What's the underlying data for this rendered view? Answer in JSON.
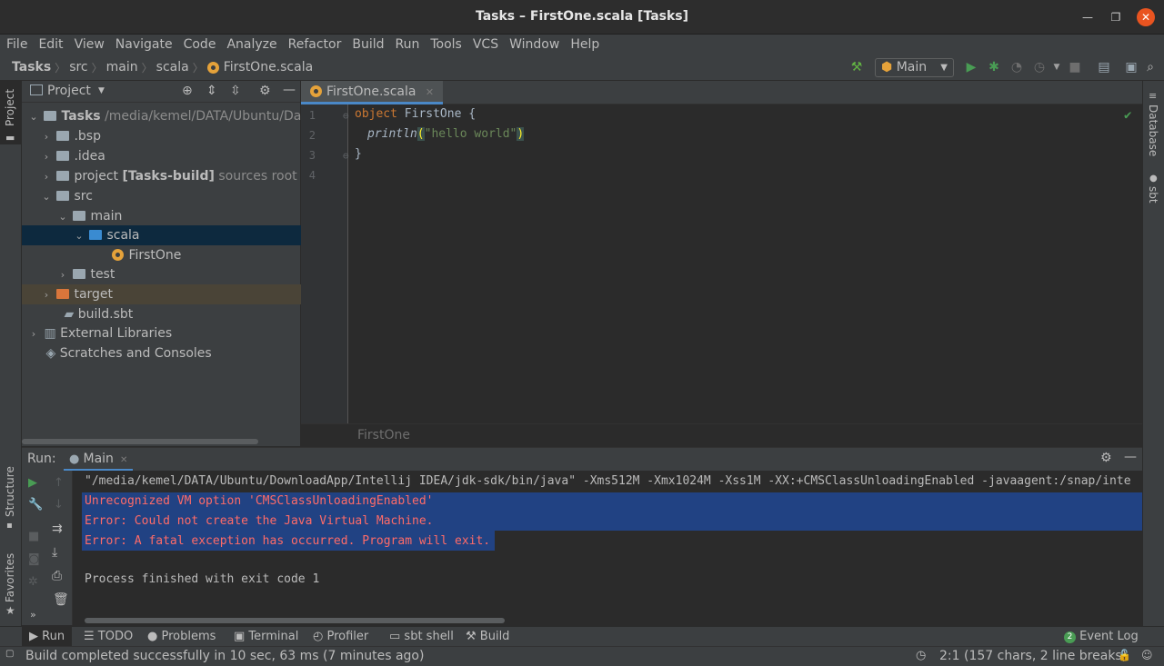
{
  "window": {
    "title": "Tasks – FirstOne.scala [Tasks]"
  },
  "menu": [
    "File",
    "Edit",
    "View",
    "Navigate",
    "Code",
    "Analyze",
    "Refactor",
    "Build",
    "Run",
    "Tools",
    "VCS",
    "Window",
    "Help"
  ],
  "nav": {
    "crumbs": [
      "Tasks",
      "src",
      "main",
      "scala",
      "FirstOne.scala"
    ],
    "run_config": "Main"
  },
  "left_strip": {
    "project_label": "Project",
    "structure_label": "Structure",
    "favorites_label": "Favorites"
  },
  "right_strip": {
    "database_label": "Database",
    "sbt_label": "sbt"
  },
  "project_panel": {
    "title": "Project",
    "tree": [
      {
        "label": "Tasks",
        "suffix": "/media/kemel/DATA/Ubuntu/Da",
        "bold": true
      },
      {
        "label": ".bsp"
      },
      {
        "label": ".idea"
      },
      {
        "label": "project",
        "bold_suffix": "[Tasks-build]",
        "suffix": "sources root"
      },
      {
        "label": "src"
      },
      {
        "label": "main"
      },
      {
        "label": "scala"
      },
      {
        "label": "FirstOne"
      },
      {
        "label": "test"
      },
      {
        "label": "target"
      },
      {
        "label": "build.sbt"
      },
      {
        "label": "External Libraries"
      },
      {
        "label": "Scratches and Consoles"
      }
    ]
  },
  "editor": {
    "tab": "FirstOne.scala",
    "line_numbers": [
      "1",
      "2",
      "3",
      "4"
    ],
    "code": {
      "l1_kw": "object",
      "l1_rest": " FirstOne {",
      "l2_fn": "println",
      "l2_open": "(",
      "l2_str": "\"hello world\"",
      "l2_close": ")",
      "l3": "}"
    },
    "breadcrumb": "FirstOne"
  },
  "run": {
    "label": "Run:",
    "tab": "Main",
    "console": [
      "\"/media/kemel/DATA/Ubuntu/DownloadApp/Intellij IDEA/jdk-sdk/bin/java\" -Xms512M -Xmx1024M -Xss1M -XX:+CMSClassUnloadingEnabled -javaagent:/snap/inte",
      "Unrecognized VM option 'CMSClassUnloadingEnabled'",
      "Error: Could not create the Java Virtual Machine.",
      "Error: A fatal exception has occurred. Program will exit.",
      "",
      "Process finished with exit code 1"
    ]
  },
  "bottom_tools": [
    "Run",
    "TODO",
    "Problems",
    "Terminal",
    "Profiler",
    "sbt shell",
    "Build"
  ],
  "event_log": {
    "count": "2",
    "label": "Event Log"
  },
  "status": {
    "message": "Build completed successfully in 10 sec, 63 ms (7 minutes ago)",
    "position": "2:1 (157 chars, 2 line breaks)"
  },
  "colors": {
    "accent": "#4a88c7",
    "error_text": "#ff6b68",
    "selection": "#214283",
    "run_green": "#499c54",
    "close_button": "#e95420"
  }
}
